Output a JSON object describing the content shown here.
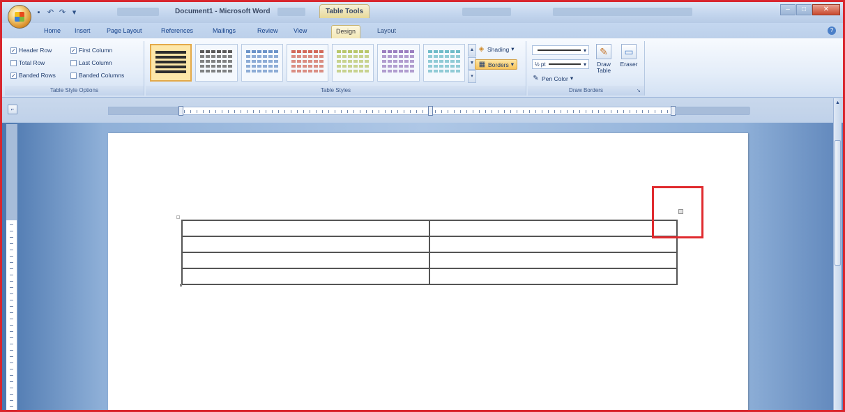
{
  "window": {
    "title": "Document1 - Microsoft Word",
    "context_title": "Table Tools",
    "qat_icons": [
      "save-icon",
      "undo-icon",
      "redo-icon",
      "customize-icon"
    ]
  },
  "tabs": [
    "Home",
    "Insert",
    "Page Layout",
    "References",
    "Mailings",
    "Review",
    "View",
    "Design",
    "Layout"
  ],
  "active_tab": "Design",
  "ribbon": {
    "table_style_options": {
      "label": "Table Style Options",
      "header_row": "Header Row",
      "first_column": "First Column",
      "total_row": "Total Row",
      "last_column": "Last Column",
      "banded_rows": "Banded Rows",
      "banded_columns": "Banded Columns",
      "checked": {
        "header_row": true,
        "first_column": true,
        "total_row": false,
        "last_column": false,
        "banded_rows": true,
        "banded_columns": false
      }
    },
    "table_styles": {
      "label": "Table Styles",
      "swatch_colors": [
        "#2d2d2d",
        "#5a5a5a",
        "#6b93c9",
        "#d26a5a",
        "#b9c76b",
        "#9b7fc0",
        "#6fbcc9"
      ]
    },
    "shading_label": "Shading",
    "borders_label": "Borders",
    "draw_borders": {
      "label": "Draw Borders",
      "line_weight": "½ pt",
      "pen_color": "Pen Color",
      "draw_table": "Draw Table",
      "eraser": "Eraser"
    }
  },
  "document": {
    "table": {
      "rows": 4,
      "cols": 2
    }
  },
  "colors": {
    "accent": "#d8262e",
    "ribbon_active": "#fde5a4"
  }
}
